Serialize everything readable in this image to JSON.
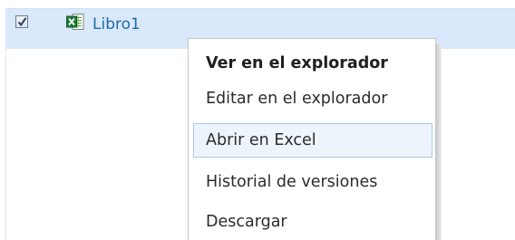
{
  "file_row": {
    "checked": true,
    "icon": "excel-file-icon",
    "name": "Libro1"
  },
  "context_menu": {
    "items": [
      {
        "label": "Ver en el explorador",
        "default": true
      },
      {
        "label": "Editar en el explorador"
      },
      {
        "label": "Abrir en Excel",
        "highlighted": true
      },
      {
        "label": "Historial de versiones"
      },
      {
        "label": "Descargar"
      }
    ]
  },
  "colors": {
    "row_selected": "#dae8fb",
    "link": "#1e6ba8",
    "menu_hover_bg": "#edf4fc",
    "menu_hover_border": "#a9cbef",
    "excel_green": "#1f7a3a"
  }
}
